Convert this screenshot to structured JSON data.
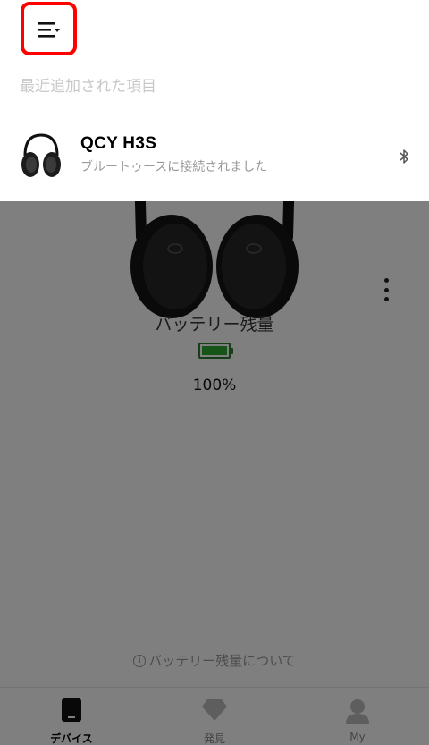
{
  "menu": {
    "icon": "menu-icon"
  },
  "recent": {
    "title": "最近追加された項目",
    "device": {
      "name": "QCY H3S",
      "status": "ブルートゥースに接続されました",
      "connection_icon": "bluetooth-icon"
    }
  },
  "battery": {
    "title": "バッテリー残量",
    "percent": "100%",
    "level": 1.0,
    "info_link": "バッテリー残量について"
  },
  "tabs": [
    {
      "label": "デバイス",
      "icon": "device-icon",
      "active": true
    },
    {
      "label": "発見",
      "icon": "diamond-icon",
      "active": false
    },
    {
      "label": "My",
      "icon": "user-icon",
      "active": false
    }
  ],
  "colors": {
    "highlight": "#ff0000",
    "battery_green": "#2fa82f",
    "scrim": "rgba(0,0,0,0.5)"
  }
}
